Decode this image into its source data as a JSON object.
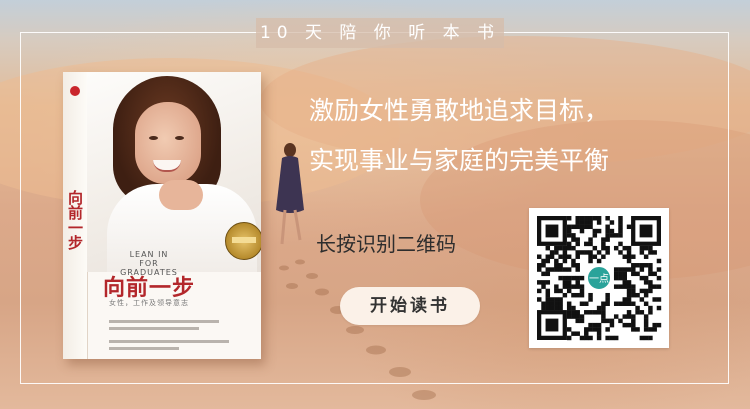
{
  "banner": {
    "title": "10 天 陪 你 听 本 书",
    "slogan_line1": "激励女性勇敢地追求目标，",
    "slogan_line2": "实现事业与家庭的完美平衡",
    "qr_caption": "长按识别二维码",
    "start_button": "开始读书"
  },
  "book": {
    "spine_title": "向前一步",
    "cover_title": "向前一步",
    "cover_english": "LEAN IN",
    "cover_english_sub": "FOR GRADUATES",
    "subtitle": "女性，工作及领导意志"
  },
  "qr": {
    "center_badge": "一点"
  },
  "colors": {
    "frame": "#ffffff",
    "title_bg": "#d6bcaa",
    "accent_red": "#b3272b",
    "button_bg": "#fbf1e8"
  }
}
